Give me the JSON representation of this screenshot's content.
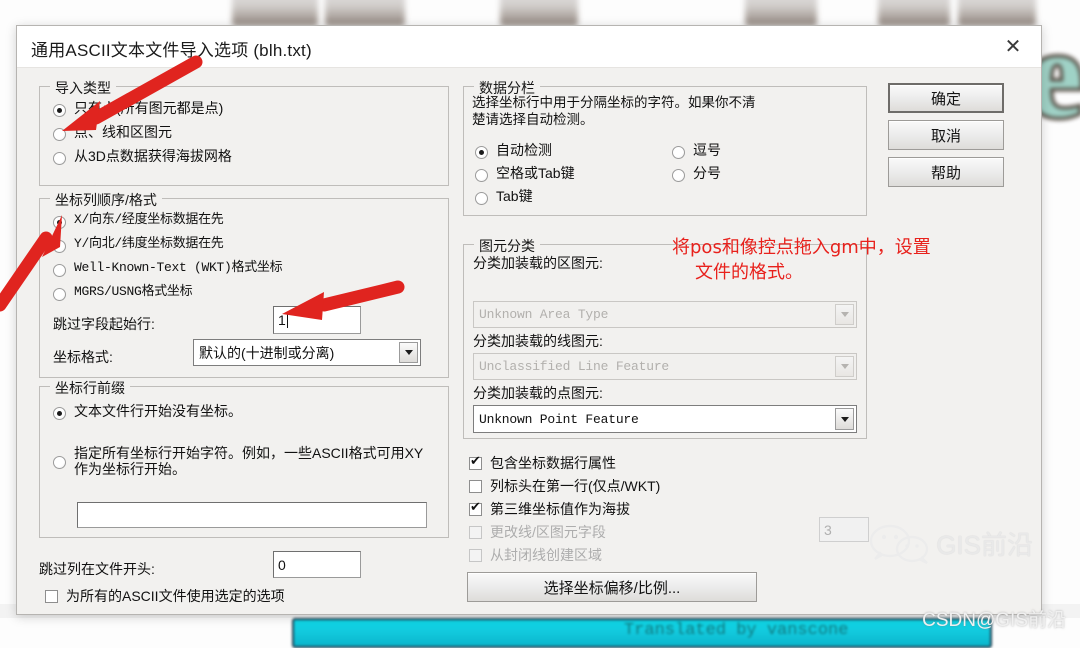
{
  "dialog": {
    "title": "通用ASCII文本文件导入选项 (blh.txt)",
    "close_icon": "close-icon"
  },
  "import_type": {
    "legend": "导入类型",
    "options": [
      {
        "label": "只有点(所有图元都是点)",
        "selected": true
      },
      {
        "label": "点、线和区图元",
        "selected": false
      },
      {
        "label": "从3D点数据获得海拔网格",
        "selected": false
      }
    ]
  },
  "coord_order": {
    "legend": "坐标列顺序/格式",
    "options": [
      {
        "label": "X/向东/经度坐标数据在先",
        "selected": true
      },
      {
        "label": "Y/向北/纬度坐标数据在先",
        "selected": false
      },
      {
        "label": "Well-Known-Text (WKT)格式坐标",
        "selected": false
      },
      {
        "label": "MGRS/USNG格式坐标",
        "selected": false
      }
    ],
    "skip_rows_label": "跳过字段起始行:",
    "skip_rows_value": "1",
    "coord_format_label": "坐标格式:",
    "coord_format_value": "默认的(十进制或分离)"
  },
  "line_prefix": {
    "legend": "坐标行前缀",
    "options": [
      {
        "label": "文本文件行开始没有坐标。",
        "selected": true
      },
      {
        "label": "指定所有坐标行开始字符。例如，一些ASCII格式可用XY作为坐标行开始。",
        "selected": false
      }
    ],
    "prefix_value": ""
  },
  "bottom_left": {
    "skip_cols_label": "跳过列在文件开头:",
    "skip_cols_value": "0",
    "apply_all_label": "为所有的ASCII文件使用选定的选项",
    "apply_all_checked": false
  },
  "data_split": {
    "legend": "数据分栏",
    "description_line1": "选择坐标行中用于分隔坐标的字符。如果你不清",
    "description_line2": "楚请选择自动检测。",
    "options_left": [
      {
        "label": "自动检测",
        "selected": true
      },
      {
        "label": "空格或Tab键",
        "selected": false
      },
      {
        "label": "Tab键",
        "selected": false
      }
    ],
    "options_right": [
      {
        "label": "逗号",
        "selected": false
      },
      {
        "label": "分号",
        "selected": false
      }
    ]
  },
  "feature_class": {
    "legend": "图元分类",
    "area_label": "分类加装载的区图元:",
    "area_value": "Unknown Area Type",
    "area_enabled": false,
    "line_label": "分类加装载的线图元:",
    "line_value": "Unclassified Line Feature",
    "line_enabled": false,
    "point_label": "分类加装载的点图元:",
    "point_value": "Unknown Point Feature",
    "point_enabled": true
  },
  "checkboxes": [
    {
      "label": "包含坐标数据行属性",
      "checked": true,
      "enabled": true
    },
    {
      "label": "列标头在第一行(仅点/WKT)",
      "checked": false,
      "enabled": true
    },
    {
      "label": "第三维坐标值作为海拔",
      "checked": true,
      "enabled": true
    },
    {
      "label": "更改线/区图元字段",
      "checked": false,
      "enabled": false
    },
    {
      "label": "从封闭线创建区域",
      "checked": false,
      "enabled": false
    }
  ],
  "field_value_count": "3",
  "offset_button_label": "选择坐标偏移/比例...",
  "action_buttons": [
    {
      "label": "确定",
      "default": true
    },
    {
      "label": "取消",
      "default": false
    },
    {
      "label": "帮助",
      "default": false
    }
  ],
  "annotation": {
    "line1": "将pos和像控点拖入gm中，设置",
    "line2": "文件的格式。",
    "color": "#e8211c"
  },
  "background": {
    "translated_text": "Translated by vanscone",
    "green_letters": "e"
  },
  "watermarks": {
    "wechat_icon": "wechat-icon",
    "brand": "GIS前沿",
    "csdn": "CSDN@GIS前沿"
  }
}
